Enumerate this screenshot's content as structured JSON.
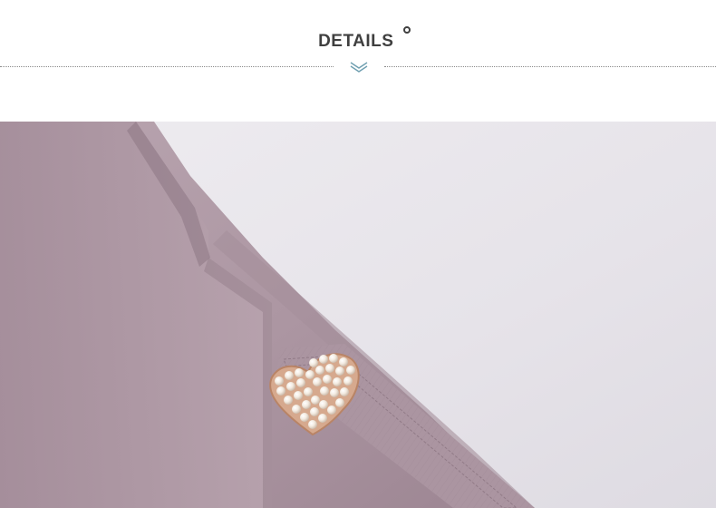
{
  "header": {
    "title": "DETAILS"
  },
  "icons": {
    "title_mark": "ring-dot-icon",
    "divider_mark": "double-chevron-down-icon"
  },
  "photo": {
    "subject": "product-detail-photo",
    "colors": {
      "fabric": "#b09aa6",
      "fabric_shadow": "#8d7683",
      "background": "#e7e5ea",
      "pearl": "#f4ede4",
      "accent": "#3f3f3f",
      "chevron": "#6f9fb0"
    }
  }
}
